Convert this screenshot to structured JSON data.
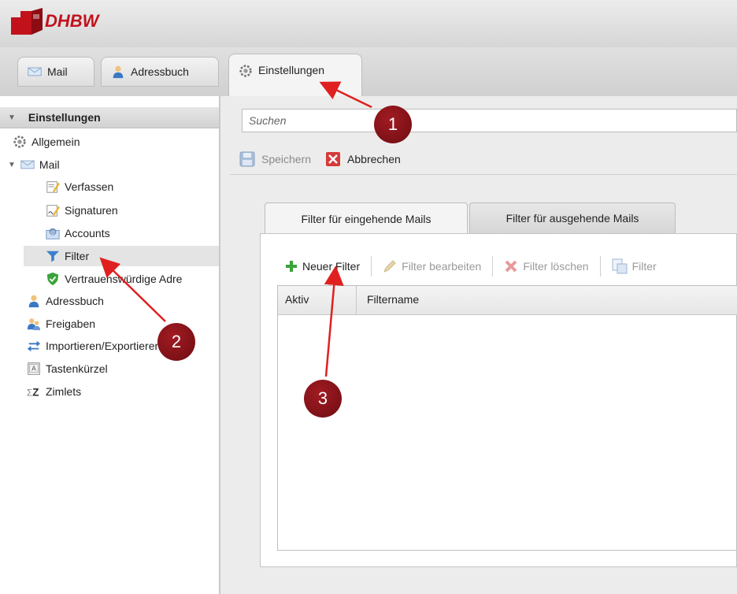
{
  "header": {
    "logo_text": "DHBW"
  },
  "app_tabs": [
    {
      "label": "Mail",
      "icon": "envelope-icon"
    },
    {
      "label": "Adressbuch",
      "icon": "contact-icon"
    },
    {
      "label": "Einstellungen",
      "icon": "gear-icon",
      "active": true
    }
  ],
  "sidebar": {
    "title": "Einstellungen",
    "items": [
      {
        "label": "Allgemein",
        "icon": "gear-icon"
      },
      {
        "label": "Mail",
        "icon": "envelope-icon"
      },
      {
        "label": "Verfassen",
        "icon": "compose-icon"
      },
      {
        "label": "Signaturen",
        "icon": "signature-icon"
      },
      {
        "label": "Accounts",
        "icon": "accounts-icon"
      },
      {
        "label": "Filter",
        "icon": "filter-icon",
        "selected": true
      },
      {
        "label": "Vertrauenswürdige Adre",
        "icon": "shield-icon"
      },
      {
        "label": "Adressbuch",
        "icon": "contact-icon"
      },
      {
        "label": "Freigaben",
        "icon": "sharing-icon"
      },
      {
        "label": "Importieren/Exportieren",
        "icon": "import-export-icon"
      },
      {
        "label": "Tastenkürzel",
        "icon": "keyboard-icon"
      },
      {
        "label": "Zimlets",
        "icon": "zimlet-icon"
      }
    ]
  },
  "search": {
    "placeholder": "Suchen"
  },
  "toolbar": {
    "save_label": "Speichern",
    "cancel_label": "Abbrechen"
  },
  "filter_tabs": [
    {
      "label": "Filter für eingehende Mails",
      "active": true
    },
    {
      "label": "Filter für ausgehende Mails"
    }
  ],
  "filter_toolbar": {
    "new_label": "Neuer Filter",
    "edit_label": "Filter bearbeiten",
    "delete_label": "Filter löschen",
    "run_label": "Filter"
  },
  "grid": {
    "columns": [
      "Aktiv",
      "Filtername"
    ],
    "rows": []
  },
  "annotations": [
    {
      "number": "1"
    },
    {
      "number": "2"
    },
    {
      "number": "3"
    }
  ],
  "colors": {
    "brand_red": "#c1121c",
    "marker": "#8b141b",
    "arrow": "#e02020",
    "add_green": "#3aa33a",
    "delete_red": "#d33"
  }
}
